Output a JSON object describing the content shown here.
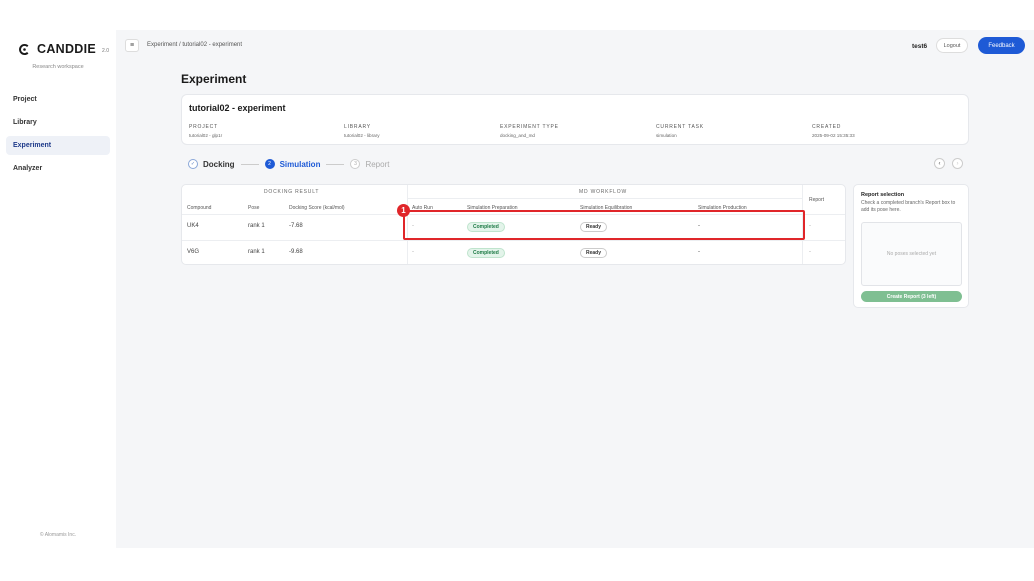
{
  "brand": {
    "name": "CANDDIE",
    "version": "2.0",
    "subtitle": "Research workspace"
  },
  "sidebar": {
    "items": [
      {
        "label": "Project"
      },
      {
        "label": "Library"
      },
      {
        "label": "Experiment",
        "active": true
      },
      {
        "label": "Analyzer"
      }
    ],
    "copyright": "© Alomamis Inc."
  },
  "topbar": {
    "breadcrumb": "Experiment / tutorial02 - experiment",
    "user": "test6",
    "logout_label": "Logout",
    "feedback_label": "Feedback"
  },
  "page_title": "Experiment",
  "experiment": {
    "name": "tutorial02 - experiment",
    "meta": [
      {
        "key": "PROJECT",
        "value": "tutorial02 - glp1r"
      },
      {
        "key": "LIBRARY",
        "value": "tutorial02 - library"
      },
      {
        "key": "EXPERIMENT TYPE",
        "value": "docking_and_md"
      },
      {
        "key": "CURRENT TASK",
        "value": "simulation"
      },
      {
        "key": "CREATED",
        "value": "2025-09-02 15:35:33"
      }
    ]
  },
  "stepper": {
    "steps": [
      {
        "num": "✓",
        "label": "Docking",
        "state": "done"
      },
      {
        "num": "2",
        "label": "Simulation",
        "state": "active"
      },
      {
        "num": "3",
        "label": "Report",
        "state": "pending"
      }
    ]
  },
  "table": {
    "group_docking": "DOCKING RESULT",
    "group_md": "MD WORKFLOW",
    "headers": {
      "compound": "Compound",
      "pose": "Pose",
      "score": "Docking Score (kcal/mol)",
      "auto_run": "Auto Run",
      "prep": "Simulation Preparation",
      "equil": "Simulation Equilibration",
      "prod": "Simulation Production",
      "report": "Report"
    },
    "rows": [
      {
        "compound": "UK4",
        "pose": "rank 1",
        "score": "-7.68",
        "auto_run": "-",
        "prep": "Completed",
        "equil": "Ready",
        "prod": "-",
        "report": "-"
      },
      {
        "compound": "V6G",
        "pose": "rank 1",
        "score": "-9.68",
        "auto_run": "-",
        "prep": "Completed",
        "equil": "Ready",
        "prod": "-",
        "report": "-"
      }
    ]
  },
  "annotation": {
    "badge": "1",
    "color": "#e0262a"
  },
  "report_selection": {
    "title": "Report selection",
    "description": "Check a completed branch's Report box to add its pose here.",
    "empty_text": "No poses selected yet",
    "button_label": "Create Report (3 left)"
  },
  "colors": {
    "accent": "#1e5ad6",
    "success": "#1d7a45",
    "highlight": "#e0262a"
  }
}
